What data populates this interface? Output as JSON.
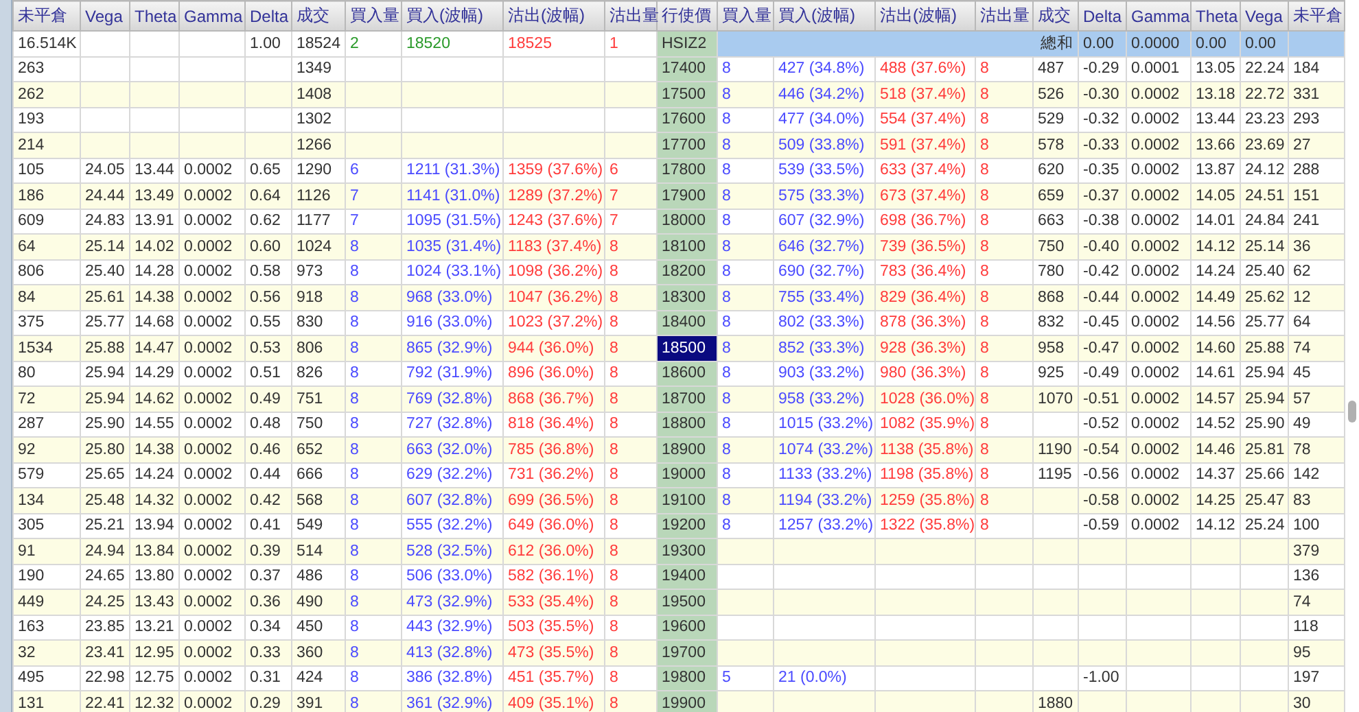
{
  "left_columns": [
    "未平倉",
    "Vega",
    "Theta",
    "Gamma",
    "Delta",
    "成交",
    "買入量",
    "買入(波幅)",
    "沽出(波幅)",
    "沽出量"
  ],
  "strike_column": "行使價",
  "right_columns": [
    "買入量",
    "買入(波幅)",
    "沽出(波幅)",
    "沽出量",
    "成交",
    "Delta",
    "Gamma",
    "Theta",
    "Vega",
    "未平倉"
  ],
  "summary": {
    "call": {
      "oi": "16.514K",
      "delta": "1.00",
      "volume": "18524",
      "bid_qty": "2",
      "bid": "18520",
      "ask": "18525",
      "ask_qty": "1"
    },
    "strike": "HSIZ2",
    "total_label": "總和",
    "put": {
      "delta": "0.00",
      "gamma": "0.0000",
      "theta": "0.00",
      "vega": "0.00"
    }
  },
  "rows": [
    {
      "strike": "17400",
      "selected": false,
      "call": {
        "oi": "263",
        "volume": "1349"
      },
      "put": {
        "bid_qty": "8",
        "bid": "427 (34.8%)",
        "ask": "488 (37.6%)",
        "ask_qty": "8",
        "volume": "487",
        "delta": "-0.29",
        "gamma": "0.0001",
        "theta": "13.05",
        "vega": "22.24",
        "oi": "184"
      }
    },
    {
      "strike": "17500",
      "selected": false,
      "call": {
        "oi": "262",
        "volume": "1408"
      },
      "put": {
        "bid_qty": "8",
        "bid": "446 (34.2%)",
        "ask": "518 (37.4%)",
        "ask_qty": "8",
        "volume": "526",
        "delta": "-0.30",
        "gamma": "0.0002",
        "theta": "13.18",
        "vega": "22.72",
        "oi": "331"
      }
    },
    {
      "strike": "17600",
      "selected": false,
      "call": {
        "oi": "193",
        "volume": "1302"
      },
      "put": {
        "bid_qty": "8",
        "bid": "477 (34.0%)",
        "ask": "554 (37.4%)",
        "ask_qty": "8",
        "volume": "529",
        "delta": "-0.32",
        "gamma": "0.0002",
        "theta": "13.44",
        "vega": "23.23",
        "oi": "293"
      }
    },
    {
      "strike": "17700",
      "selected": false,
      "call": {
        "oi": "214",
        "volume": "1266"
      },
      "put": {
        "bid_qty": "8",
        "bid": "509 (33.8%)",
        "ask": "591 (37.4%)",
        "ask_qty": "8",
        "volume": "578",
        "delta": "-0.33",
        "gamma": "0.0002",
        "theta": "13.66",
        "vega": "23.69",
        "oi": "27"
      }
    },
    {
      "strike": "17800",
      "selected": false,
      "call": {
        "oi": "105",
        "vega": "24.05",
        "theta": "13.44",
        "gamma": "0.0002",
        "delta": "0.65",
        "volume": "1290",
        "bid_qty": "6",
        "bid": "1211 (31.3%)",
        "ask": "1359 (37.6%)",
        "ask_qty": "6"
      },
      "put": {
        "bid_qty": "8",
        "bid": "539 (33.5%)",
        "ask": "633 (37.4%)",
        "ask_qty": "8",
        "volume": "620",
        "delta": "-0.35",
        "gamma": "0.0002",
        "theta": "13.87",
        "vega": "24.12",
        "oi": "288"
      }
    },
    {
      "strike": "17900",
      "selected": false,
      "call": {
        "oi": "186",
        "vega": "24.44",
        "theta": "13.49",
        "gamma": "0.0002",
        "delta": "0.64",
        "volume": "1126",
        "bid_qty": "7",
        "bid": "1141 (31.0%)",
        "ask": "1289 (37.2%)",
        "ask_qty": "7"
      },
      "put": {
        "bid_qty": "8",
        "bid": "575 (33.3%)",
        "ask": "673 (37.4%)",
        "ask_qty": "8",
        "volume": "659",
        "delta": "-0.37",
        "gamma": "0.0002",
        "theta": "14.05",
        "vega": "24.51",
        "oi": "151"
      }
    },
    {
      "strike": "18000",
      "selected": false,
      "call": {
        "oi": "609",
        "vega": "24.83",
        "theta": "13.91",
        "gamma": "0.0002",
        "delta": "0.62",
        "volume": "1177",
        "bid_qty": "7",
        "bid": "1095 (31.5%)",
        "ask": "1243 (37.6%)",
        "ask_qty": "7"
      },
      "put": {
        "bid_qty": "8",
        "bid": "607 (32.9%)",
        "ask": "698 (36.7%)",
        "ask_qty": "8",
        "volume": "663",
        "delta": "-0.38",
        "gamma": "0.0002",
        "theta": "14.01",
        "vega": "24.84",
        "oi": "241"
      }
    },
    {
      "strike": "18100",
      "selected": false,
      "call": {
        "oi": "64",
        "vega": "25.14",
        "theta": "14.02",
        "gamma": "0.0002",
        "delta": "0.60",
        "volume": "1024",
        "bid_qty": "8",
        "bid": "1035 (31.4%)",
        "ask": "1183 (37.4%)",
        "ask_qty": "8"
      },
      "put": {
        "bid_qty": "8",
        "bid": "646 (32.7%)",
        "ask": "739 (36.5%)",
        "ask_qty": "8",
        "volume": "750",
        "delta": "-0.40",
        "gamma": "0.0002",
        "theta": "14.12",
        "vega": "25.14",
        "oi": "36"
      }
    },
    {
      "strike": "18200",
      "selected": false,
      "call": {
        "oi": "806",
        "vega": "25.40",
        "theta": "14.28",
        "gamma": "0.0002",
        "delta": "0.58",
        "volume": "973",
        "bid_qty": "8",
        "bid": "1024 (33.1%)",
        "ask": "1098 (36.2%)",
        "ask_qty": "8"
      },
      "put": {
        "bid_qty": "8",
        "bid": "690 (32.7%)",
        "ask": "783 (36.4%)",
        "ask_qty": "8",
        "volume": "780",
        "delta": "-0.42",
        "gamma": "0.0002",
        "theta": "14.24",
        "vega": "25.40",
        "oi": "62"
      }
    },
    {
      "strike": "18300",
      "selected": false,
      "call": {
        "oi": "84",
        "vega": "25.61",
        "theta": "14.38",
        "gamma": "0.0002",
        "delta": "0.56",
        "volume": "918",
        "bid_qty": "8",
        "bid": "968 (33.0%)",
        "ask": "1047 (36.2%)",
        "ask_qty": "8"
      },
      "put": {
        "bid_qty": "8",
        "bid": "755 (33.4%)",
        "ask": "829 (36.4%)",
        "ask_qty": "8",
        "volume": "868",
        "delta": "-0.44",
        "gamma": "0.0002",
        "theta": "14.49",
        "vega": "25.62",
        "oi": "12"
      }
    },
    {
      "strike": "18400",
      "selected": false,
      "call": {
        "oi": "375",
        "vega": "25.77",
        "theta": "14.68",
        "gamma": "0.0002",
        "delta": "0.55",
        "volume": "830",
        "bid_qty": "8",
        "bid": "916 (33.0%)",
        "ask": "1023 (37.2%)",
        "ask_qty": "8"
      },
      "put": {
        "bid_qty": "8",
        "bid": "802 (33.3%)",
        "ask": "878 (36.3%)",
        "ask_qty": "8",
        "volume": "832",
        "delta": "-0.45",
        "gamma": "0.0002",
        "theta": "14.56",
        "vega": "25.77",
        "oi": "64"
      }
    },
    {
      "strike": "18500",
      "selected": true,
      "call": {
        "oi": "1534",
        "vega": "25.88",
        "theta": "14.47",
        "gamma": "0.0002",
        "delta": "0.53",
        "volume": "806",
        "bid_qty": "8",
        "bid": "865 (32.9%)",
        "ask": "944 (36.0%)",
        "ask_qty": "8"
      },
      "put": {
        "bid_qty": "8",
        "bid": "852 (33.3%)",
        "ask": "928 (36.3%)",
        "ask_qty": "8",
        "volume": "958",
        "delta": "-0.47",
        "gamma": "0.0002",
        "theta": "14.60",
        "vega": "25.88",
        "oi": "74"
      }
    },
    {
      "strike": "18600",
      "selected": false,
      "call": {
        "oi": "80",
        "vega": "25.94",
        "theta": "14.29",
        "gamma": "0.0002",
        "delta": "0.51",
        "volume": "826",
        "bid_qty": "8",
        "bid": "792 (31.9%)",
        "ask": "896 (36.0%)",
        "ask_qty": "8"
      },
      "put": {
        "bid_qty": "8",
        "bid": "903 (33.2%)",
        "ask": "980 (36.3%)",
        "ask_qty": "8",
        "volume": "925",
        "delta": "-0.49",
        "gamma": "0.0002",
        "theta": "14.61",
        "vega": "25.94",
        "oi": "45"
      }
    },
    {
      "strike": "18700",
      "selected": false,
      "call": {
        "oi": "72",
        "vega": "25.94",
        "theta": "14.62",
        "gamma": "0.0002",
        "delta": "0.49",
        "volume": "751",
        "bid_qty": "8",
        "bid": "769 (32.8%)",
        "ask": "868 (36.7%)",
        "ask_qty": "8"
      },
      "put": {
        "bid_qty": "8",
        "bid": "958 (33.2%)",
        "ask": "1028 (36.0%)",
        "ask_qty": "8",
        "volume": "1070",
        "delta": "-0.51",
        "gamma": "0.0002",
        "theta": "14.57",
        "vega": "25.94",
        "oi": "57"
      }
    },
    {
      "strike": "18800",
      "selected": false,
      "call": {
        "oi": "287",
        "vega": "25.90",
        "theta": "14.55",
        "gamma": "0.0002",
        "delta": "0.48",
        "volume": "750",
        "bid_qty": "8",
        "bid": "727 (32.8%)",
        "ask": "818 (36.4%)",
        "ask_qty": "8"
      },
      "put": {
        "bid_qty": "8",
        "bid": "1015 (33.2%)",
        "ask": "1082 (35.9%)",
        "ask_qty": "8",
        "delta": "-0.52",
        "gamma": "0.0002",
        "theta": "14.52",
        "vega": "25.90",
        "oi": "49"
      }
    },
    {
      "strike": "18900",
      "selected": false,
      "call": {
        "oi": "92",
        "vega": "25.80",
        "theta": "14.38",
        "gamma": "0.0002",
        "delta": "0.46",
        "volume": "652",
        "bid_qty": "8",
        "bid": "663 (32.0%)",
        "ask": "785 (36.8%)",
        "ask_qty": "8"
      },
      "put": {
        "bid_qty": "8",
        "bid": "1074 (33.2%)",
        "ask": "1138 (35.8%)",
        "ask_qty": "8",
        "volume": "1190",
        "delta": "-0.54",
        "gamma": "0.0002",
        "theta": "14.46",
        "vega": "25.81",
        "oi": "78"
      }
    },
    {
      "strike": "19000",
      "selected": false,
      "call": {
        "oi": "579",
        "vega": "25.65",
        "theta": "14.24",
        "gamma": "0.0002",
        "delta": "0.44",
        "volume": "666",
        "bid_qty": "8",
        "bid": "629 (32.2%)",
        "ask": "731 (36.2%)",
        "ask_qty": "8"
      },
      "put": {
        "bid_qty": "8",
        "bid": "1133 (33.2%)",
        "ask": "1198 (35.8%)",
        "ask_qty": "8",
        "volume": "1195",
        "delta": "-0.56",
        "gamma": "0.0002",
        "theta": "14.37",
        "vega": "25.66",
        "oi": "142"
      }
    },
    {
      "strike": "19100",
      "selected": false,
      "call": {
        "oi": "134",
        "vega": "25.48",
        "theta": "14.32",
        "gamma": "0.0002",
        "delta": "0.42",
        "volume": "568",
        "bid_qty": "8",
        "bid": "607 (32.8%)",
        "ask": "699 (36.5%)",
        "ask_qty": "8"
      },
      "put": {
        "bid_qty": "8",
        "bid": "1194 (33.2%)",
        "ask": "1259 (35.8%)",
        "ask_qty": "8",
        "delta": "-0.58",
        "gamma": "0.0002",
        "theta": "14.25",
        "vega": "25.47",
        "oi": "83"
      }
    },
    {
      "strike": "19200",
      "selected": false,
      "call": {
        "oi": "305",
        "vega": "25.21",
        "theta": "13.94",
        "gamma": "0.0002",
        "delta": "0.41",
        "volume": "549",
        "bid_qty": "8",
        "bid": "555 (32.2%)",
        "ask": "649 (36.0%)",
        "ask_qty": "8"
      },
      "put": {
        "bid_qty": "8",
        "bid": "1257 (33.2%)",
        "ask": "1322 (35.8%)",
        "ask_qty": "8",
        "delta": "-0.59",
        "gamma": "0.0002",
        "theta": "14.12",
        "vega": "25.24",
        "oi": "100"
      }
    },
    {
      "strike": "19300",
      "selected": false,
      "call": {
        "oi": "91",
        "vega": "24.94",
        "theta": "13.84",
        "gamma": "0.0002",
        "delta": "0.39",
        "volume": "514",
        "bid_qty": "8",
        "bid": "528 (32.5%)",
        "ask": "612 (36.0%)",
        "ask_qty": "8"
      },
      "put": {
        "oi": "379"
      }
    },
    {
      "strike": "19400",
      "selected": false,
      "call": {
        "oi": "190",
        "vega": "24.65",
        "theta": "13.80",
        "gamma": "0.0002",
        "delta": "0.37",
        "volume": "486",
        "bid_qty": "8",
        "bid": "506 (33.0%)",
        "ask": "582 (36.1%)",
        "ask_qty": "8"
      },
      "put": {
        "oi": "136"
      }
    },
    {
      "strike": "19500",
      "selected": false,
      "call": {
        "oi": "449",
        "vega": "24.25",
        "theta": "13.43",
        "gamma": "0.0002",
        "delta": "0.36",
        "volume": "490",
        "bid_qty": "8",
        "bid": "473 (32.9%)",
        "ask": "533 (35.4%)",
        "ask_qty": "8"
      },
      "put": {
        "oi": "74"
      }
    },
    {
      "strike": "19600",
      "selected": false,
      "call": {
        "oi": "163",
        "vega": "23.85",
        "theta": "13.21",
        "gamma": "0.0002",
        "delta": "0.34",
        "volume": "450",
        "bid_qty": "8",
        "bid": "443 (32.9%)",
        "ask": "503 (35.5%)",
        "ask_qty": "8"
      },
      "put": {
        "oi": "118"
      }
    },
    {
      "strike": "19700",
      "selected": false,
      "call": {
        "oi": "32",
        "vega": "23.41",
        "theta": "12.95",
        "gamma": "0.0002",
        "delta": "0.33",
        "volume": "360",
        "bid_qty": "8",
        "bid": "413 (32.8%)",
        "ask": "473 (35.5%)",
        "ask_qty": "8"
      },
      "put": {
        "oi": "95"
      }
    },
    {
      "strike": "19800",
      "selected": false,
      "call": {
        "oi": "495",
        "vega": "22.98",
        "theta": "12.75",
        "gamma": "0.0002",
        "delta": "0.31",
        "volume": "424",
        "bid_qty": "8",
        "bid": "386 (32.8%)",
        "ask": "451 (35.7%)",
        "ask_qty": "8"
      },
      "put": {
        "bid_qty": "5",
        "bid": "21 (0.0%)",
        "delta": "-1.00",
        "oi": "197"
      }
    },
    {
      "strike": "19900",
      "selected": false,
      "call": {
        "oi": "131",
        "vega": "22.41",
        "theta": "12.32",
        "gamma": "0.0002",
        "delta": "0.29",
        "volume": "391",
        "bid_qty": "8",
        "bid": "361 (32.9%)",
        "ask": "409 (35.1%)",
        "ask_qty": "8"
      },
      "put": {
        "volume": "1880",
        "oi": "30"
      }
    }
  ]
}
